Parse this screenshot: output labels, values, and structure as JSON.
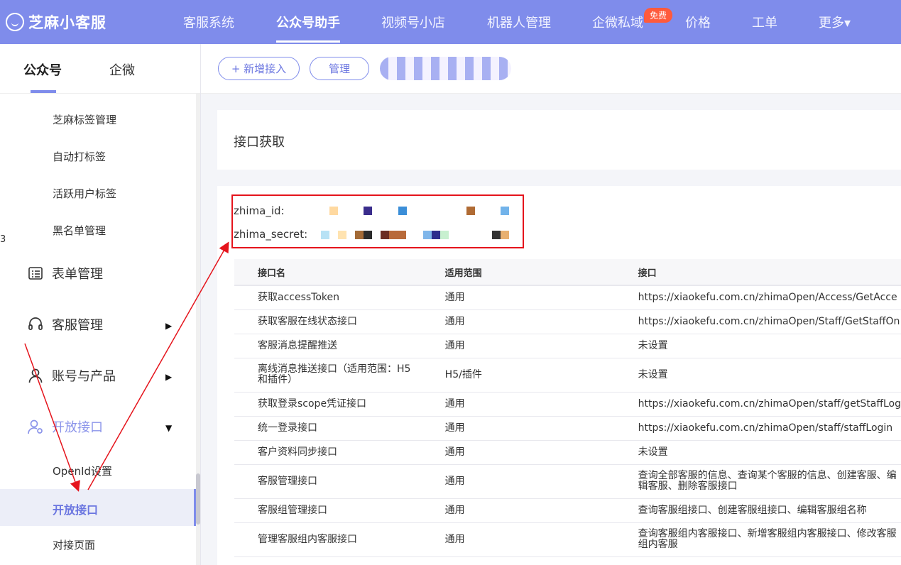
{
  "header": {
    "logo_text": "芝麻小客服",
    "nav": [
      "客服系统",
      "公众号助手",
      "视频号小店",
      "机器人管理",
      "企微私域",
      "价格",
      "工单",
      "更多▾"
    ],
    "active_nav": "公众号助手",
    "free_badge": "免费"
  },
  "sidebar": {
    "tabs": [
      "公众号",
      "企微"
    ],
    "sub_items_top": [
      "芝麻标签管理",
      "自动打标签",
      "活跃用户标签",
      "黑名单管理"
    ],
    "menu": [
      {
        "label": "表单管理",
        "icon": "list-icon"
      },
      {
        "label": "客服管理",
        "icon": "headset-icon"
      },
      {
        "label": "账号与产品",
        "icon": "user-icon"
      },
      {
        "label": "开放接口",
        "icon": "user-gear-icon"
      }
    ],
    "sub_items_bottom": [
      "OpenId设置",
      "开放接口",
      "对接页面"
    ],
    "edge_glyph": "3"
  },
  "toolbar": {
    "add_label": "+ 新增接入",
    "manage_label": "管理"
  },
  "section_title": "接口获取",
  "credentials": {
    "id_label": "zhima_id:",
    "secret_label": "zhima_secret:"
  },
  "table": {
    "headers": [
      "接口名",
      "适用范围",
      "接口"
    ],
    "rows": [
      [
        "获取accessToken",
        "通用",
        "https://xiaokefu.com.cn/zhimaOpen/Access/GetAcce"
      ],
      [
        "获取客服在线状态接口",
        "通用",
        "https://xiaokefu.com.cn/zhimaOpen/Staff/GetStaffOn"
      ],
      [
        "客服消息提醒推送",
        "通用",
        "未设置"
      ],
      [
        "离线消息推送接口（适用范围：H5和插件）",
        "H5/插件",
        "未设置"
      ],
      [
        "获取登录scope凭证接口",
        "通用",
        "https://xiaokefu.com.cn/zhimaOpen/staff/getStaffLog"
      ],
      [
        "统一登录接口",
        "通用",
        "https://xiaokefu.com.cn/zhimaOpen/staff/staffLogin"
      ],
      [
        "客户资料同步接口",
        "通用",
        "未设置"
      ],
      [
        "客服管理接口",
        "通用",
        "查询全部客服的信息、查询某个客服的信息、创建客服、编辑客服、删除客服接口"
      ],
      [
        "客服组管理接口",
        "通用",
        "查询客服组接口、创建客服组接口、编辑客服组名称"
      ],
      [
        "管理客服组内客服接口",
        "通用",
        "查询客服组内客服接口、新增客服组内客服接口、修改客服组内客服"
      ]
    ]
  },
  "colors": {
    "brand": "#7f8ceb",
    "annotation": "#e5141c",
    "active_text": "#6b76e0"
  }
}
